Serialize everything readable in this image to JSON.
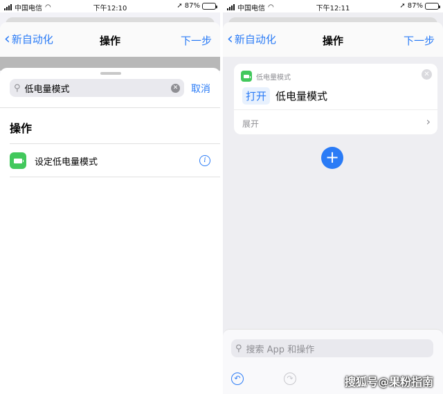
{
  "left": {
    "status": {
      "carrier": "中国电信",
      "time": "下午12:10",
      "battery": "87%"
    },
    "nav": {
      "back": "新自动化",
      "title": "操作",
      "next": "下一步"
    },
    "search": {
      "value": "低电量模式",
      "cancel": "取消"
    },
    "section": "操作",
    "result": {
      "label": "设定低电量模式"
    }
  },
  "right": {
    "status": {
      "carrier": "中国电信",
      "time": "下午12:11",
      "battery": "87%"
    },
    "nav": {
      "back": "新自动化",
      "title": "操作",
      "next": "下一步"
    },
    "card": {
      "header": "低电量模式",
      "verb": "打开",
      "object": "低电量模式",
      "expand": "展开"
    },
    "search_placeholder": "搜索 App 和操作",
    "watermark": "搜狐号@果粉指南"
  },
  "battery_level": 0.87,
  "colors": {
    "accent": "#2a7bf6",
    "battery_green": "#42c85c"
  },
  "icons": [
    "signal-icon",
    "wifi-icon",
    "location-icon",
    "battery-icon",
    "search-icon",
    "clear-icon",
    "info-icon",
    "close-icon",
    "chevron-right-icon",
    "plus-icon",
    "undo-icon",
    "redo-icon"
  ]
}
